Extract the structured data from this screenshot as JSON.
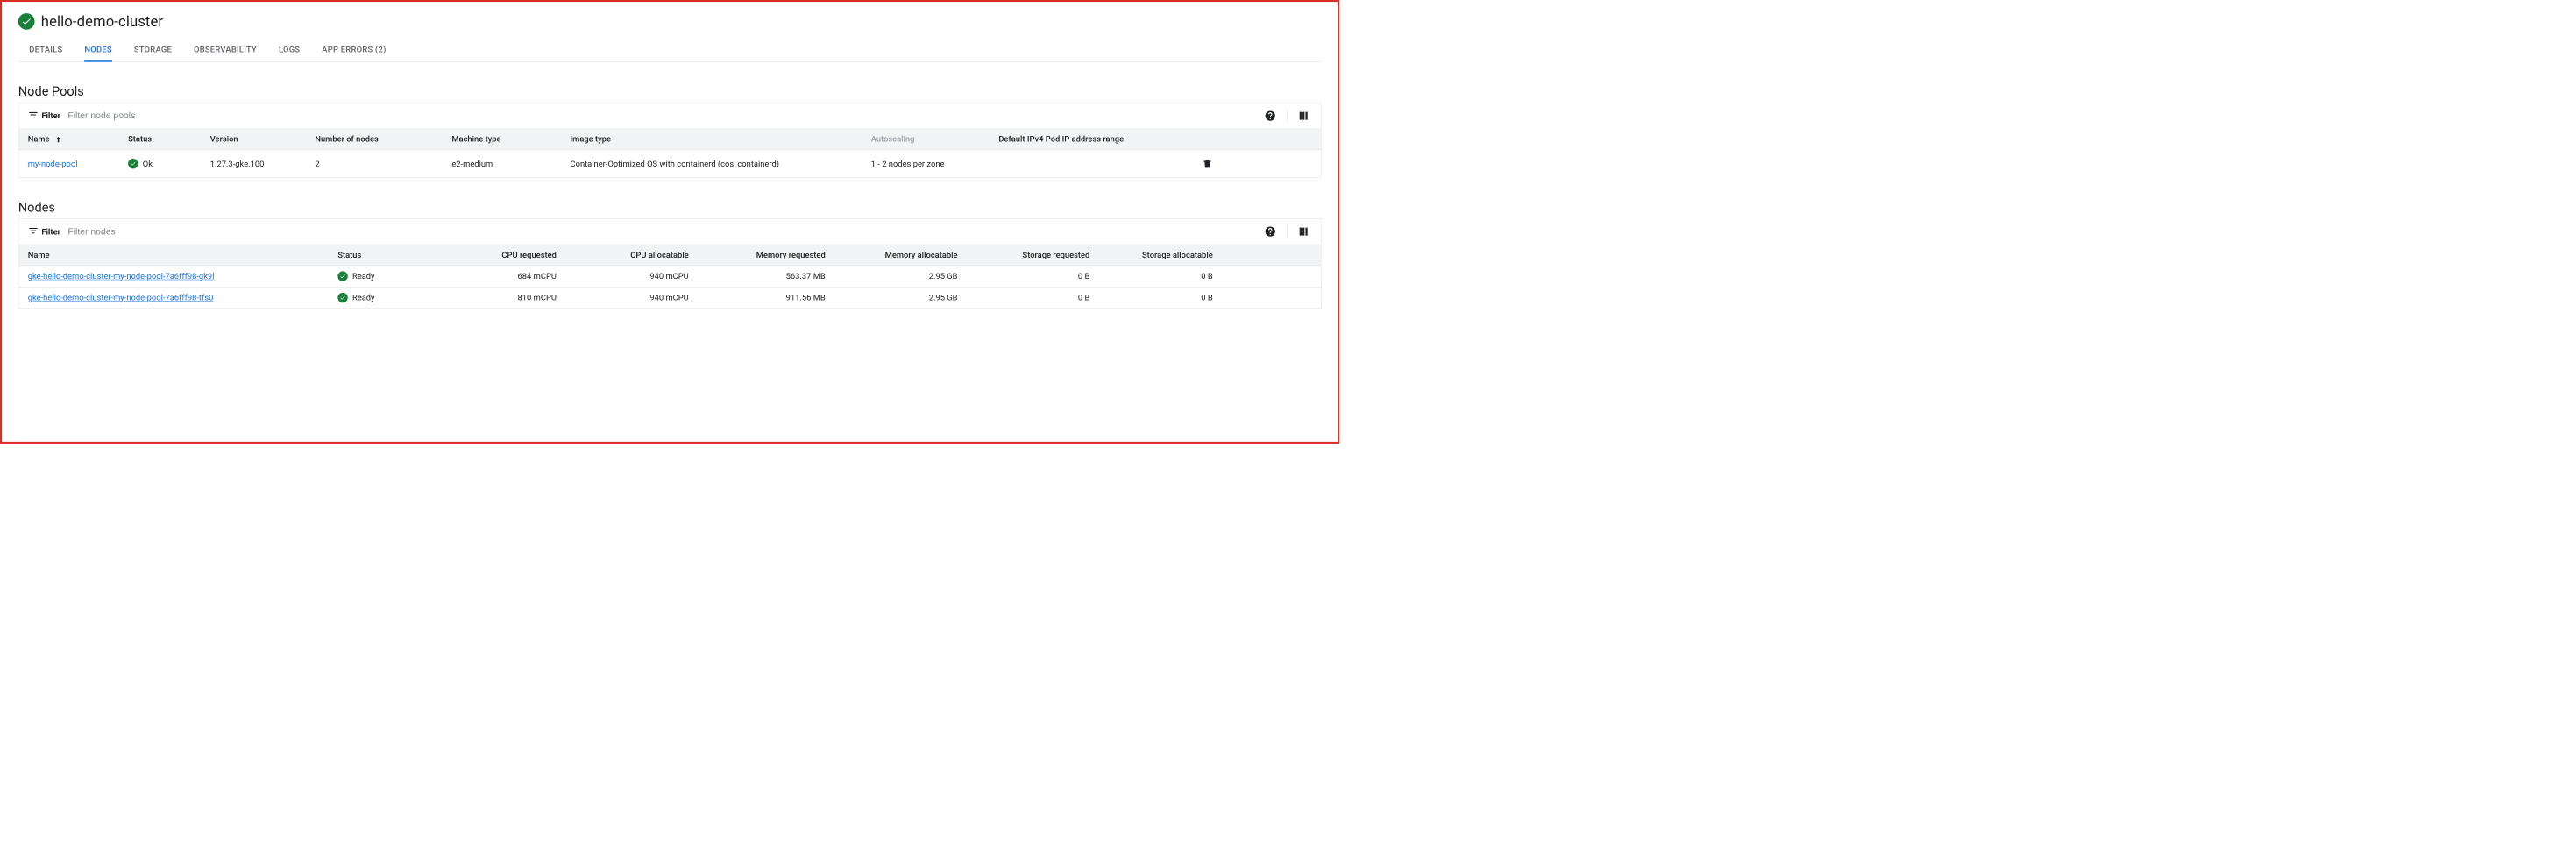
{
  "header": {
    "title": "hello-demo-cluster"
  },
  "tabs": [
    {
      "label": "DETAILS",
      "active": false
    },
    {
      "label": "NODES",
      "active": true
    },
    {
      "label": "STORAGE",
      "active": false
    },
    {
      "label": "OBSERVABILITY",
      "active": false
    },
    {
      "label": "LOGS",
      "active": false
    },
    {
      "label": "APP ERRORS (2)",
      "active": false
    }
  ],
  "pools": {
    "section_title": "Node Pools",
    "filter_label": "Filter",
    "filter_placeholder": "Filter node pools",
    "columns": {
      "name": "Name",
      "status": "Status",
      "version": "Version",
      "nodes": "Number of nodes",
      "machine": "Machine type",
      "image": "Image type",
      "autoscaling": "Autoscaling",
      "podrange": "Default IPv4 Pod IP address range"
    },
    "rows": [
      {
        "name": "my-node-pool",
        "status": "Ok",
        "version": "1.27.3-gke.100",
        "nodes": "2",
        "machine": "e2-medium",
        "image": "Container-Optimized OS with containerd (cos_containerd)",
        "autoscaling": "1 - 2 nodes per zone",
        "podrange": ""
      }
    ]
  },
  "nodes": {
    "section_title": "Nodes",
    "filter_label": "Filter",
    "filter_placeholder": "Filter nodes",
    "columns": {
      "name": "Name",
      "status": "Status",
      "cpu_req": "CPU requested",
      "cpu_alloc": "CPU allocatable",
      "mem_req": "Memory requested",
      "mem_alloc": "Memory allocatable",
      "stor_req": "Storage requested",
      "stor_alloc": "Storage allocatable"
    },
    "rows": [
      {
        "name": "gke-hello-demo-cluster-my-node-pool-7a6fff98-gk9l",
        "status": "Ready",
        "cpu_req": "684 mCPU",
        "cpu_alloc": "940 mCPU",
        "mem_req": "563.37 MB",
        "mem_alloc": "2.95 GB",
        "stor_req": "0 B",
        "stor_alloc": "0 B"
      },
      {
        "name": "gke-hello-demo-cluster-my-node-pool-7a6fff98-tfs0",
        "status": "Ready",
        "cpu_req": "810 mCPU",
        "cpu_alloc": "940 mCPU",
        "mem_req": "911.56 MB",
        "mem_alloc": "2.95 GB",
        "stor_req": "0 B",
        "stor_alloc": "0 B"
      }
    ]
  }
}
